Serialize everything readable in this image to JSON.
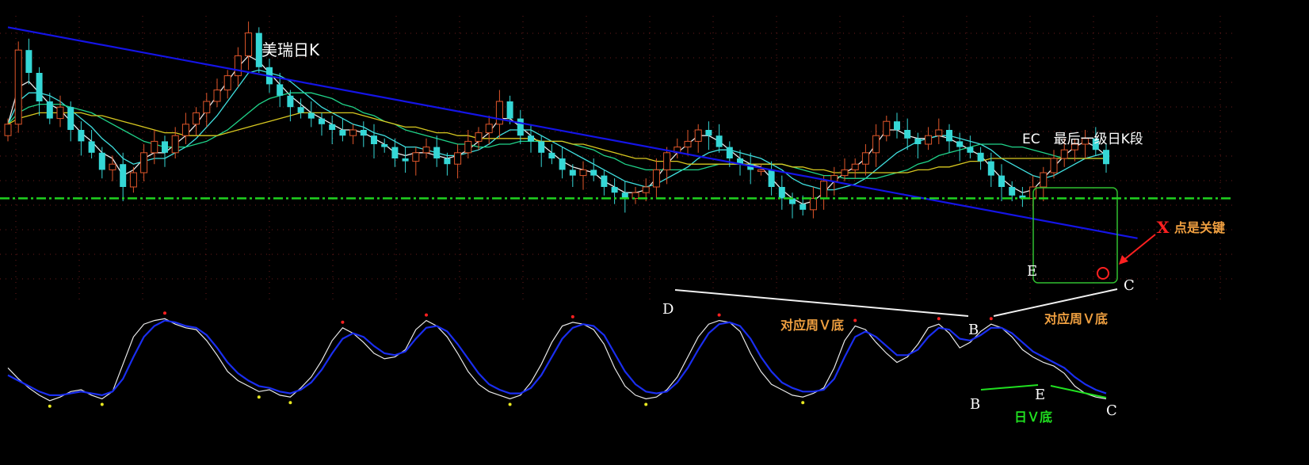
{
  "colors": {
    "background": "#000000",
    "grid": "#6b1b1b",
    "candle_up": "#e0562a",
    "candle_down": "#35d7d6",
    "trendline": "#1414e6",
    "support": "#1fd11f",
    "ma_yellow": "#d8c820",
    "ma_green": "#20d48a",
    "ma_cyan": "#40e0e0",
    "ma_white": "#e8e8e8",
    "osc_fast": "#e8e8e8",
    "osc_slow": "#1a2ef0",
    "dot_top": "#ff2020",
    "dot_bottom": "#e8e820",
    "text_white": "#ffffff",
    "text_orange": "#f0a040",
    "text_green": "#20e020",
    "text_red": "#ff2020",
    "box_green": "#30c030"
  },
  "annotations": {
    "title": "美瑞日K",
    "segment_label": "EC　最后一级日K段",
    "key_point": "点是关键",
    "key_x": "X",
    "weekly_v1": "对应周Ｖ底",
    "weekly_v2": "对应周Ｖ底",
    "daily_v": "日Ｖ底",
    "point_D": "D",
    "point_B_upper": "B",
    "point_E_upper": "E",
    "point_C_upper": "C",
    "point_B_lower": "B",
    "point_E_lower": "E",
    "point_C_lower": "C"
  },
  "chart_data": [
    {
      "type": "candlestick",
      "title": "美瑞日K",
      "legend": "none",
      "grid": true,
      "ylim": [
        0,
        100
      ],
      "trend_line": [
        [
          0,
          96
        ],
        [
          108,
          22
        ]
      ],
      "support_level": 36,
      "series": [
        {
          "name": "",
          "close": [
            62,
            88,
            80,
            70,
            64,
            68,
            60,
            56,
            52,
            46,
            48,
            40,
            45,
            52,
            56,
            52,
            58,
            62,
            66,
            70,
            74,
            79,
            86,
            94,
            82,
            76,
            72,
            68,
            66,
            64,
            62,
            60,
            58,
            60,
            58,
            55,
            54,
            50,
            49,
            52,
            54,
            50,
            48,
            52,
            56,
            59,
            62,
            70,
            64,
            58,
            56,
            52,
            50,
            46,
            44,
            46,
            44,
            40,
            38,
            36,
            38,
            40,
            46,
            52,
            54,
            56,
            60,
            58,
            54,
            50,
            48,
            46,
            46,
            40,
            36,
            34,
            32,
            36,
            42,
            44,
            46,
            48,
            52,
            58,
            63,
            60,
            57,
            55,
            58,
            60,
            56,
            54,
            52,
            49,
            44,
            40,
            37,
            36,
            40,
            45,
            50,
            53,
            55,
            57,
            53,
            48
          ]
        },
        {
          "name": "",
          "ma_period": 5,
          "values": [
            62,
            75,
            77,
            73,
            69,
            67,
            63,
            59,
            56,
            52,
            50,
            44,
            46,
            50,
            52,
            52,
            55,
            58,
            62,
            67,
            72,
            77,
            82,
            86,
            84,
            80,
            76,
            72,
            69,
            66,
            64,
            62,
            60,
            60,
            59,
            57,
            55,
            52,
            51,
            52,
            52,
            51,
            50,
            51,
            53,
            56,
            59,
            64,
            64,
            61,
            58,
            55,
            52,
            49,
            47,
            46,
            45,
            42,
            40,
            38,
            38,
            39,
            43,
            48,
            52,
            55,
            58,
            58,
            56,
            53,
            50,
            48,
            47,
            43,
            39,
            36,
            34,
            35,
            38,
            42,
            45,
            47,
            50,
            55,
            60,
            60,
            58,
            57,
            57,
            58,
            57,
            55,
            53,
            51,
            47,
            43,
            40,
            38,
            39,
            43,
            47,
            51,
            54,
            56,
            54,
            51
          ]
        },
        {
          "name": "",
          "ma_period": 10,
          "values": [
            62,
            70,
            73,
            73,
            72,
            70,
            67,
            64,
            61,
            57,
            54,
            50,
            48,
            49,
            50,
            50,
            52,
            54,
            57,
            61,
            65,
            70,
            75,
            80,
            81,
            80,
            79,
            77,
            74,
            71,
            68,
            66,
            64,
            62,
            61,
            59,
            58,
            56,
            54,
            54,
            53,
            52,
            51,
            51,
            52,
            53,
            55,
            58,
            60,
            60,
            60,
            58,
            56,
            54,
            52,
            50,
            48,
            46,
            44,
            42,
            41,
            40,
            41,
            43,
            45,
            47,
            50,
            52,
            53,
            53,
            52,
            51,
            50,
            48,
            46,
            43,
            41,
            40,
            39,
            39,
            40,
            41,
            43,
            46,
            49,
            52,
            54,
            56,
            57,
            58,
            58,
            57,
            56,
            55,
            53,
            50,
            48,
            46,
            44,
            43,
            44,
            46,
            48,
            50,
            51,
            52
          ]
        },
        {
          "name": "",
          "ma_period": 20,
          "values": [
            62,
            66,
            68,
            69,
            69,
            69,
            68,
            67,
            66,
            64,
            62,
            60,
            58,
            56,
            55,
            54,
            54,
            54,
            55,
            56,
            58,
            60,
            63,
            66,
            69,
            71,
            72,
            73,
            73,
            73,
            72,
            71,
            69,
            68,
            66,
            65,
            63,
            62,
            60,
            59,
            58,
            57,
            56,
            55,
            55,
            54,
            54,
            55,
            55,
            56,
            56,
            56,
            56,
            56,
            55,
            54,
            53,
            51,
            50,
            48,
            47,
            46,
            46,
            46,
            46,
            46,
            46,
            47,
            48,
            48,
            48,
            48,
            48,
            48,
            48,
            47,
            46,
            45,
            44,
            44,
            43,
            43,
            43,
            43,
            44,
            45,
            46,
            48,
            49,
            51,
            52,
            53,
            54,
            55,
            55,
            55,
            54,
            54,
            53,
            52,
            51,
            50,
            50,
            50,
            50,
            50
          ]
        },
        {
          "name": "",
          "ma_period": 30,
          "values": [
            62,
            64,
            65,
            66,
            66,
            66,
            66,
            66,
            65,
            65,
            64,
            63,
            62,
            61,
            60,
            59,
            59,
            58,
            58,
            58,
            58,
            59,
            60,
            61,
            62,
            63,
            64,
            65,
            66,
            66,
            66,
            66,
            66,
            66,
            65,
            64,
            63,
            62,
            61,
            61,
            60,
            59,
            59,
            58,
            58,
            57,
            57,
            57,
            57,
            57,
            57,
            56,
            56,
            56,
            55,
            55,
            54,
            53,
            52,
            51,
            50,
            50,
            49,
            49,
            49,
            48,
            48,
            48,
            48,
            48,
            48,
            48,
            48,
            48,
            48,
            47,
            47,
            46,
            46,
            45,
            45,
            45,
            45,
            45,
            45,
            45,
            45,
            46,
            46,
            47,
            47,
            48,
            49,
            49,
            50,
            50,
            50,
            50,
            50,
            50,
            50,
            50,
            50,
            50,
            50,
            50
          ]
        }
      ]
    },
    {
      "type": "line",
      "legend": "none",
      "grid": false,
      "ylim": [
        0,
        100
      ],
      "series": [
        {
          "name": "",
          "values": [
            44,
            32,
            22,
            14,
            8,
            12,
            18,
            20,
            14,
            10,
            18,
            48,
            78,
            92,
            96,
            98,
            92,
            88,
            86,
            74,
            58,
            40,
            30,
            24,
            18,
            20,
            14,
            12,
            22,
            34,
            52,
            74,
            88,
            82,
            72,
            60,
            54,
            56,
            64,
            86,
            96,
            90,
            78,
            60,
            40,
            26,
            18,
            14,
            10,
            14,
            28,
            48,
            72,
            90,
            94,
            92,
            86,
            70,
            44,
            24,
            14,
            10,
            12,
            20,
            34,
            56,
            78,
            92,
            96,
            94,
            84,
            60,
            40,
            26,
            20,
            14,
            12,
            16,
            22,
            44,
            74,
            90,
            86,
            72,
            60,
            50,
            56,
            70,
            88,
            92,
            82,
            66,
            72,
            84,
            92,
            88,
            78,
            64,
            56,
            50,
            46,
            38,
            24,
            16,
            12,
            10
          ]
        },
        {
          "name": "",
          "values": [
            36,
            30,
            24,
            18,
            14,
            14,
            16,
            18,
            16,
            14,
            18,
            32,
            56,
            78,
            90,
            96,
            94,
            90,
            88,
            80,
            66,
            50,
            38,
            30,
            24,
            22,
            18,
            16,
            20,
            28,
            42,
            60,
            76,
            82,
            78,
            68,
            60,
            58,
            62,
            76,
            88,
            90,
            84,
            70,
            54,
            38,
            26,
            20,
            16,
            16,
            22,
            36,
            56,
            76,
            88,
            92,
            90,
            80,
            60,
            40,
            26,
            18,
            16,
            18,
            28,
            44,
            64,
            82,
            92,
            94,
            90,
            76,
            56,
            40,
            28,
            22,
            18,
            18,
            20,
            32,
            56,
            78,
            84,
            78,
            68,
            58,
            58,
            64,
            78,
            88,
            86,
            76,
            74,
            80,
            88,
            88,
            82,
            72,
            62,
            56,
            50,
            44,
            34,
            26,
            20,
            16
          ]
        }
      ]
    }
  ]
}
